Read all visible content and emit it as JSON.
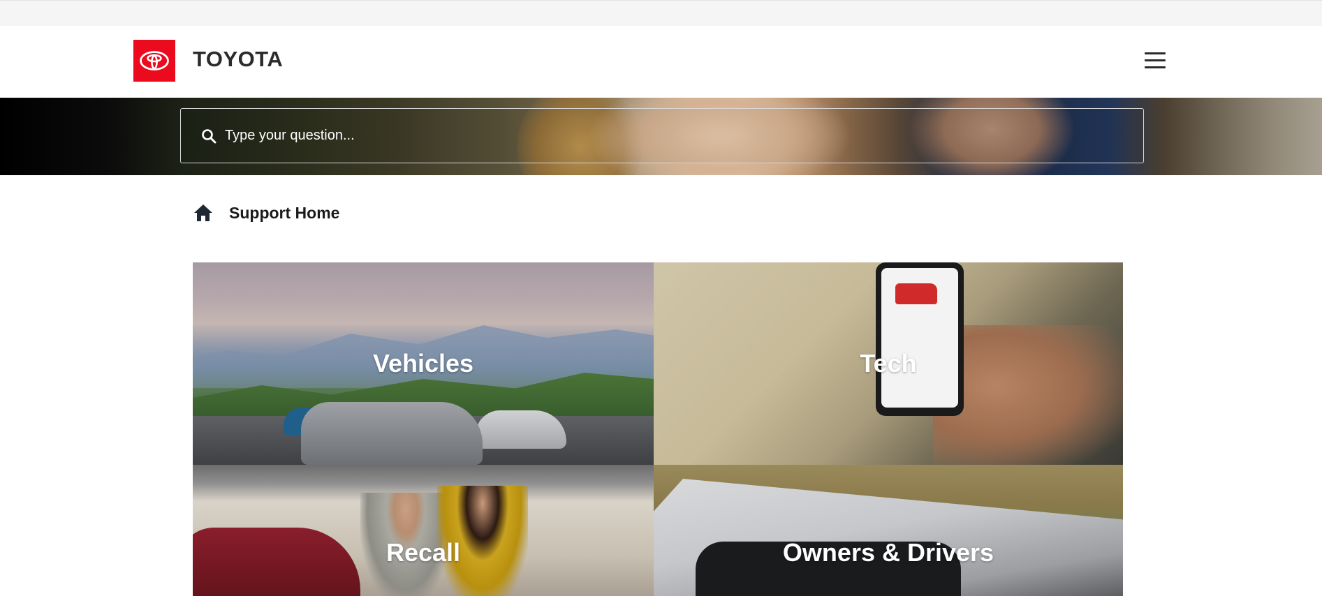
{
  "header": {
    "brand": "TOYOTA",
    "logo_color": "#eb0a1e",
    "menu_icon": "hamburger-menu-icon"
  },
  "search": {
    "placeholder": "Type your question...",
    "icon": "search-icon"
  },
  "breadcrumb": {
    "icon": "home-icon",
    "label": "Support Home"
  },
  "tiles": [
    {
      "label": "Vehicles"
    },
    {
      "label": "Tech"
    },
    {
      "label": "Recall"
    },
    {
      "label": "Owners & Drivers"
    }
  ]
}
